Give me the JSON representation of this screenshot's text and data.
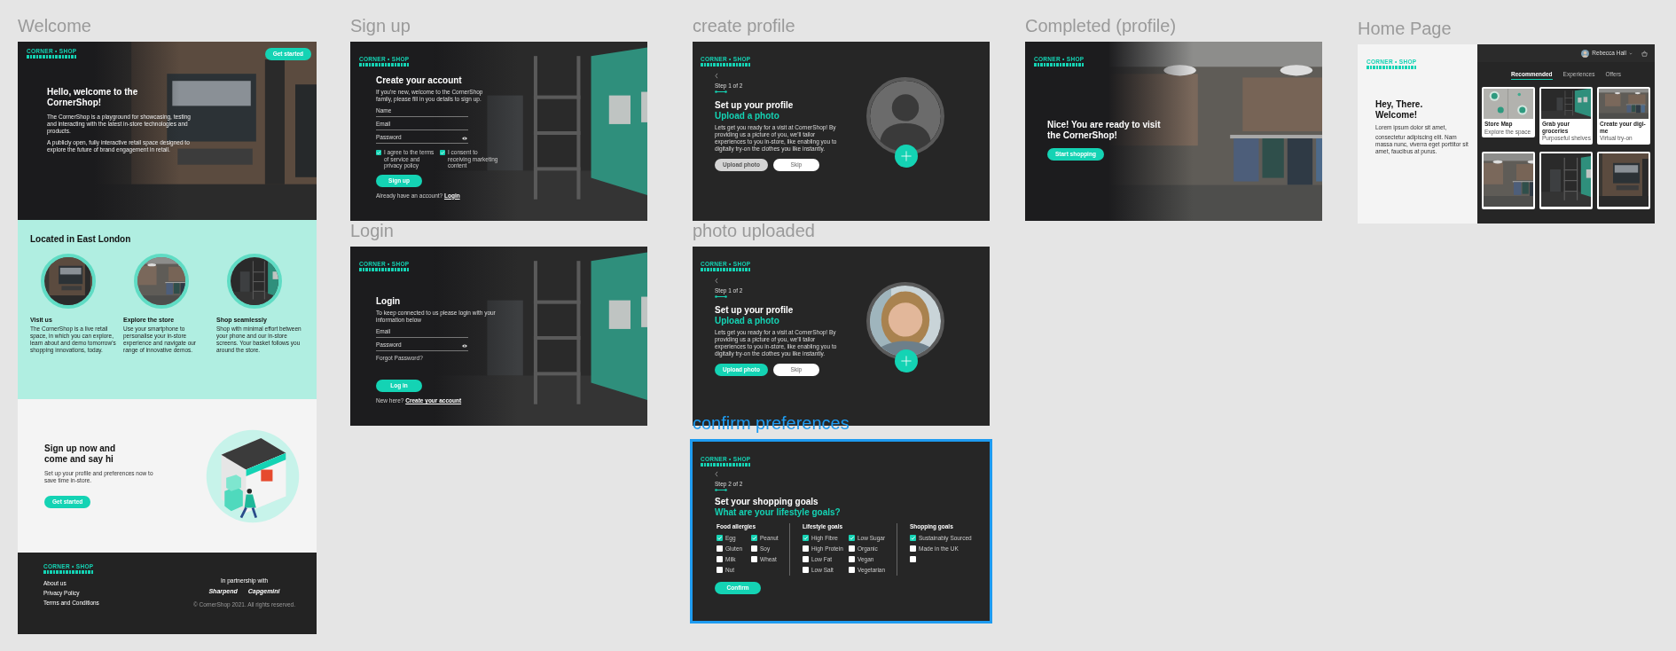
{
  "frames": [
    {
      "kind": "welcome",
      "label": "Welcome",
      "selected": false,
      "logo": "CORNER • SHOP",
      "header_button": "Get started",
      "hero": {
        "title": "Hello, welcome to the CornerShop!",
        "paragraphs": [
          "The CornerShop is a playground for showcasing, testing and interacting with the latest in-store technologies and products.",
          "A publicly open, fully interactive retail space designed to explore the future of brand engagement in retail."
        ]
      },
      "location": {
        "title": "Located in East London",
        "features": [
          {
            "title": "Visit us",
            "text": "The CornerShop is a live retail space, in which you can explore, learn about and demo tomorrow's shopping innovations, today."
          },
          {
            "title": "Explore the store",
            "text": "Use your smartphone to personalise your in-store experience and navigate our range of innovative demos."
          },
          {
            "title": "Shop seamlessly",
            "text": "Shop with minimal effort between your phone and our in-store screens. Your basket follows you around the store."
          }
        ]
      },
      "signup": {
        "title": "Sign up now and come and say hi",
        "text": "Set up your profile and preferences now to save time in-store.",
        "button": "Get started"
      },
      "footer": {
        "logo": "CORNER • SHOP",
        "links": [
          "About us",
          "Privacy Policy",
          "Terms and Conditions"
        ],
        "partner_label": "In partnership with",
        "partners": [
          "Sharpend",
          "Capgemini"
        ],
        "copyright": "© CornerShop 2021. All rights reserved."
      }
    },
    {
      "kind": "signup",
      "label": "Sign up",
      "selected": false,
      "logo": "CORNER • SHOP",
      "title": "Create your account",
      "intro": "If you're new, welcome to the CornerShop family, please fill in you details to sign up.",
      "fields": [
        {
          "kind": "text",
          "placeholder": "Name"
        },
        {
          "kind": "text",
          "placeholder": "Email"
        },
        {
          "kind": "password",
          "placeholder": "Password"
        }
      ],
      "checkboxes": [
        {
          "label": "I agree to the terms of service and privacy policy",
          "checked": true
        },
        {
          "label": "I consent to receiving marketing content",
          "checked": true
        }
      ],
      "button": "Sign up",
      "prompt": "Already have an account?",
      "link": "Login"
    },
    {
      "kind": "login",
      "label": "Login",
      "selected": false,
      "logo": "CORNER • SHOP",
      "title": "Login",
      "intro": "To keep connected to us please login with your information below",
      "fields": [
        {
          "kind": "text",
          "placeholder": "Email"
        },
        {
          "kind": "password",
          "placeholder": "Password"
        }
      ],
      "forgot": "Forgot Password?",
      "button": "Log in",
      "prompt": "New here?",
      "link": "Create your account"
    },
    {
      "kind": "profile",
      "label": "create profile",
      "selected": false,
      "logo": "CORNER • SHOP",
      "step": "Step 1 of 2",
      "title": "Set up your profile",
      "subtitle": "Upload a photo",
      "text": "Lets get you ready for a visit at CornerShop! By providing us a picture of you, we'll tailor experiences to you in-store, like enabling you to digitally try-on the clothes you like instantly.",
      "buttons": [
        {
          "label": "Upload photo",
          "kind": "primary",
          "disabled": true
        },
        {
          "label": "Skip",
          "kind": "secondary",
          "disabled": false
        }
      ],
      "avatar": {
        "kind": "silhouette"
      }
    },
    {
      "kind": "profile",
      "label": "photo uploaded",
      "selected": false,
      "logo": "CORNER • SHOP",
      "step": "Step 1 of 2",
      "title": "Set up your profile",
      "subtitle": "Upload a photo",
      "text": "Lets get you ready for a visit at CornerShop! By providing us a picture of you, we'll tailor experiences to you in-store, like enabling you to digitally try-on the clothes you like instantly.",
      "buttons": [
        {
          "label": "Upload photo",
          "kind": "primary",
          "disabled": false
        },
        {
          "label": "Skip",
          "kind": "secondary",
          "disabled": false
        }
      ],
      "avatar": {
        "kind": "picture"
      }
    },
    {
      "kind": "preferences",
      "label": "confirm preferences",
      "selected": true,
      "logo": "CORNER • SHOP",
      "step": "Step 2 of 2",
      "title": "Set your shopping goals",
      "subtitle": "What are your lifestyle goals?",
      "groups": [
        {
          "title": "Food allergies",
          "options": [
            {
              "label": "Egg",
              "checked": true
            },
            {
              "label": "Gluten",
              "checked": false
            },
            {
              "label": "Milk",
              "checked": false
            },
            {
              "label": "Nut",
              "checked": false
            },
            {
              "label": "Peanut",
              "checked": true
            },
            {
              "label": "Soy",
              "checked": false
            },
            {
              "label": "Wheat",
              "checked": false
            }
          ]
        },
        {
          "title": "Lifestyle goals",
          "options": [
            {
              "label": "High Fibre",
              "checked": true
            },
            {
              "label": "High Protein",
              "checked": false
            },
            {
              "label": "Low Fat",
              "checked": false
            },
            {
              "label": "Low Salt",
              "checked": false
            },
            {
              "label": "Low Sugar",
              "checked": true
            },
            {
              "label": "Organic",
              "checked": false
            },
            {
              "label": "Vegan",
              "checked": false
            },
            {
              "label": "Vegetarian",
              "checked": false
            }
          ]
        },
        {
          "title": "Shopping goals",
          "options": [
            {
              "label": "Sustainably Sourced",
              "checked": true
            },
            {
              "label": "Made in the UK",
              "checked": false
            },
            {
              "checked": false
            }
          ]
        }
      ],
      "button": "Confirm"
    },
    {
      "kind": "completed",
      "label": "Completed (profile)",
      "selected": false,
      "logo": "CORNER • SHOP",
      "title": "Nice! You are ready to visit the CornerShop!",
      "button": "Start shopping"
    },
    {
      "kind": "home",
      "label": "Home Page",
      "selected": false,
      "logo": "CORNER • SHOP",
      "title": "Hey, There. Welcome!",
      "paragraphs": [
        "Lorem ipsum dolor sit amet,",
        "consectetur adipiscing elit. Nam massa nunc, viverra eget porttitor sit amet, faucibus at purus."
      ],
      "user": "Rebecca Hall",
      "tabs": [
        {
          "label": "Recommended",
          "selected": true
        },
        {
          "label": "Experiences",
          "selected": false
        },
        {
          "label": "Offers",
          "selected": false
        }
      ],
      "cards": [
        {
          "title": "Store Map",
          "subtitle": "Explore the space"
        },
        {
          "title": "Grab your groceries",
          "subtitle": "Purposeful shelves"
        },
        {
          "title": "Create your digi-me",
          "subtitle": "Virtual try-on"
        },
        {
          "kind": "picture"
        },
        {
          "kind": "picture"
        },
        {
          "kind": "picture"
        }
      ]
    }
  ]
}
